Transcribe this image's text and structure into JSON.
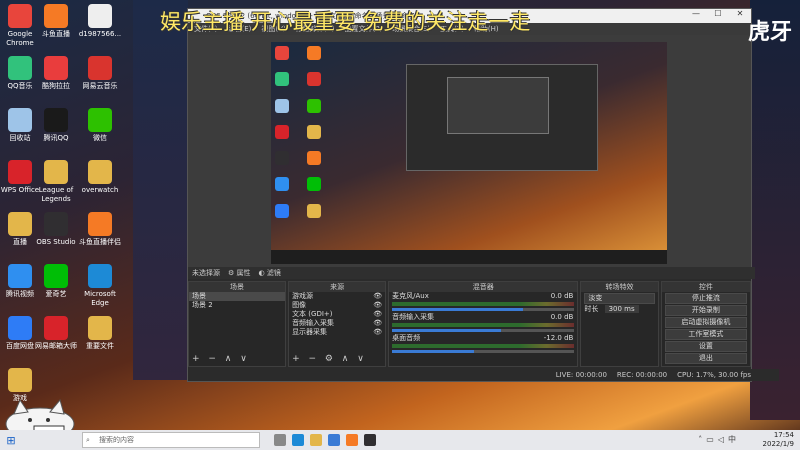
{
  "overlay": {
    "headline": "娱乐主播 开心最重要 免费的关注走一走",
    "brand": "虎牙"
  },
  "desktop_icons": [
    {
      "label": "Google Chrome",
      "color": "#e8453c",
      "icon": "chrome-icon"
    },
    {
      "label": "斗鱼直播",
      "color": "#f57a25",
      "icon": "douyu-icon"
    },
    {
      "label": "d1987566...",
      "color": "#eeeeee",
      "icon": "document-icon"
    },
    {
      "label": "QQ音乐",
      "color": "#31c27c",
      "icon": "qqmusic-icon"
    },
    {
      "label": "酷狗拉拉",
      "color": "#e93d3d",
      "icon": "app-icon"
    },
    {
      "label": "网易云音乐",
      "color": "#d9342e",
      "icon": "netease-icon"
    },
    {
      "label": "回收站",
      "color": "#9ec4e8",
      "icon": "recycle-bin-icon"
    },
    {
      "label": "腾讯QQ",
      "color": "#1a1a1a",
      "icon": "qq-icon"
    },
    {
      "label": "微信",
      "color": "#2dc100",
      "icon": "wechat-icon"
    },
    {
      "label": "WPS Office",
      "color": "#d8232a",
      "icon": "wps-icon"
    },
    {
      "label": "League of Legends",
      "color": "#e3b64a",
      "icon": "folder-icon"
    },
    {
      "label": "overwatch",
      "color": "#e3b64a",
      "icon": "folder-icon"
    },
    {
      "label": "直播",
      "color": "#e3b64a",
      "icon": "folder-icon"
    },
    {
      "label": "OBS Studio",
      "color": "#302e31",
      "icon": "obs-icon"
    },
    {
      "label": "斗鱼直播伴侣",
      "color": "#f57a25",
      "icon": "douyu-icon"
    },
    {
      "label": "腾讯视频",
      "color": "#2f8ff0",
      "icon": "tencent-video-icon"
    },
    {
      "label": "爱奇艺",
      "color": "#00be06",
      "icon": "iqiyi-icon"
    },
    {
      "label": "Microsoft Edge",
      "color": "#1d8ad6",
      "icon": "edge-icon"
    },
    {
      "label": "百度网盘",
      "color": "#2e7cf6",
      "icon": "baidu-pan-icon"
    },
    {
      "label": "网易邮箱大师",
      "color": "#d8232a",
      "icon": "mail-icon"
    },
    {
      "label": "重要文件",
      "color": "#e3b64a",
      "icon": "folder-icon"
    },
    {
      "label": "游戏",
      "color": "#e3b64a",
      "icon": "folder-icon"
    }
  ],
  "obs": {
    "title": "OBS 27.1.2 (64-bit, windows) - 配置文件: 未命名 - 场景: 未命名",
    "menu": [
      "文件(F)",
      "编辑(E)",
      "视图(V)",
      "停靠部件(D)",
      "配置文件(P)",
      "场景集合(S)",
      "工具(T)",
      "帮助(H)"
    ],
    "source_bar": {
      "status": "未选择源",
      "properties": "属性",
      "filters": "滤镜"
    },
    "scenes": {
      "header": "场景",
      "items": [
        "场景",
        "场景 2"
      ]
    },
    "sources": {
      "header": "来源",
      "items": [
        "游戏源",
        "图像",
        "文本 (GDI+)",
        "音频输入采集",
        "显示器采集"
      ]
    },
    "mixer": {
      "header": "混音器",
      "channels": [
        {
          "name": "麦克风/Aux",
          "db": "0.0 dB",
          "level": 0.72
        },
        {
          "name": "音频输入采集",
          "db": "0.0 dB",
          "level": 0.6
        },
        {
          "name": "桌面音频",
          "db": "-12.0 dB",
          "level": 0.45
        }
      ]
    },
    "transitions": {
      "header": "转场特效",
      "type": "淡变",
      "duration_label": "时长",
      "duration_value": "300 ms"
    },
    "controls": {
      "header": "控件",
      "buttons": [
        "停止推流",
        "开始录制",
        "启动虚拟摄像机",
        "工作室模式",
        "设置",
        "退出"
      ]
    },
    "status": {
      "live": "LIVE: 00:00:00",
      "rec": "REC: 00:00:00",
      "cpu": "CPU: 1.7%, 30.00 fps"
    }
  },
  "taskbar": {
    "search_placeholder": "搜索的内容",
    "time": "17:54",
    "date": "2022/1/9",
    "lang": "中"
  }
}
